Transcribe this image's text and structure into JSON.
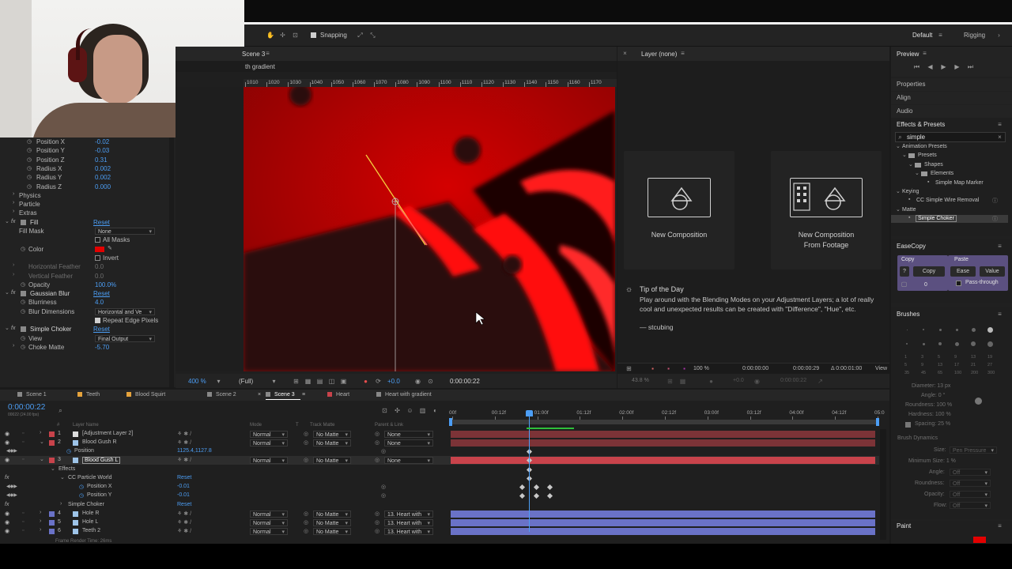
{
  "colors": {
    "accent": "#4c9ef5",
    "red_layer": "#c8434b",
    "blue_layer": "#6a72c7",
    "fill_red": "#e30000",
    "selection": "#5b5080"
  },
  "toolbar": {
    "snapping": "Snapping",
    "workspace_default": "Default",
    "workspace_rigging": "Rigging"
  },
  "composition": {
    "tab": "Scene 3",
    "breadcrumb": "th gradient",
    "ruler": [
      "1010",
      "1020",
      "1030",
      "1040",
      "1050",
      "1060",
      "1070",
      "1080",
      "1090",
      "1100",
      "1110",
      "1120",
      "1130",
      "1140",
      "1150",
      "1160",
      "1170"
    ],
    "zoom": "400 %",
    "resolution": "(Full)",
    "exposure": "+0.0",
    "timecode": "0:00:00:22"
  },
  "layer_panel": {
    "title": "Layer (none)",
    "new_comp": "New Composition",
    "new_comp_footage_1": "New Composition",
    "new_comp_footage_2": "From Footage",
    "tip_title": "Tip of the Day",
    "tip_line1": "Play around with the Blending Modes on your Adjustment Layers; a lot of really",
    "tip_line2": "cool and unexpected results can be created with \"Difference\", \"Hue\", etc.",
    "tip_author": "— stcubing",
    "footer_pct": "100 %",
    "footer_tc1": "0:00:00:00",
    "footer_tc2": "0:00:00:29",
    "footer_tc3": "Δ 0:00:01:00",
    "footer_view": "View",
    "footer2_pct": "43.8 %",
    "footer2_exp": "+0.0",
    "footer2_tc": "0:00:00:22"
  },
  "effects": {
    "rows": [
      {
        "label": "Position X",
        "value": "-0.02"
      },
      {
        "label": "Position Y",
        "value": "-0.03"
      },
      {
        "label": "Position Z",
        "value": "0.31"
      },
      {
        "label": "Radius X",
        "value": "0.002"
      },
      {
        "label": "Radius Y",
        "value": "0.002"
      },
      {
        "label": "Radius Z",
        "value": "0.000"
      }
    ],
    "physics": "Physics",
    "particle": "Particle",
    "extras": "Extras",
    "fill": "Fill",
    "reset": "Reset",
    "fill_mask": "Fill Mask",
    "fill_mask_value": "None",
    "all_masks": "All Masks",
    "color": "Color",
    "invert": "Invert",
    "h_feather": "Horizontal Feather",
    "h_feather_val": "0.0",
    "v_feather": "Vertical Feather",
    "v_feather_val": "0.0",
    "opacity": "Opacity",
    "opacity_val": "100.0%",
    "gaussian": "Gaussian Blur",
    "blurriness": "Blurriness",
    "blurriness_val": "4.0",
    "blur_dim": "Blur Dimensions",
    "blur_dim_val": "Horizontal and Ve",
    "repeat_edge": "Repeat Edge Pixels",
    "simple_choker": "Simple Choker",
    "view": "View",
    "view_val": "Final Output",
    "choke": "Choke Matte",
    "choke_val": "-5.70"
  },
  "right": {
    "preview": "Preview",
    "properties": "Properties",
    "align": "Align",
    "audio": "Audio",
    "effects_presets": "Effects & Presets",
    "search": "simple",
    "tree": [
      "Animation Presets",
      "Presets",
      "Shapes",
      "Elements",
      "Simple Map Marker",
      "Keying",
      "CC Simple Wire Removal",
      "Matte",
      "Simple Choker"
    ],
    "easecopy": "EaseCopy",
    "copy_hdr": "Copy",
    "paste_hdr": "Paste",
    "copy_btn": "Copy",
    "ease_btn": "Ease",
    "value_btn": "Value",
    "q_btn": "?",
    "zero": "0",
    "pass": "Pass-through",
    "brushes": "Brushes",
    "brush_sizes": [
      "1",
      "3",
      "5",
      "9",
      "13",
      "19",
      "5",
      "9",
      "13",
      "17",
      "21",
      "27",
      "35",
      "45",
      "65",
      "100",
      "200",
      "300"
    ],
    "diameter": "Diameter: 13 px",
    "angle": "Angle: 0 °",
    "roundness": "Roundness: 100 %",
    "hardness": "Hardness: 100 %",
    "spacing": "Spacing: 25 %",
    "dynamics": "Brush Dynamics",
    "size": "Size:",
    "size_val": "Pen Pressure",
    "min_size": "Minimum Size: 1 %",
    "angle2": "Angle:",
    "roundness2": "Roundness:",
    "opacity2": "Opacity:",
    "flow": "Flow:",
    "off": "Off",
    "paint": "Paint"
  },
  "timeline": {
    "tabs": [
      "Scene 1",
      "Teeth",
      "Blood Squirt",
      "Scene 2",
      "Scene 3",
      "Heart",
      "Heart with gradient"
    ],
    "tab_colors": [
      "#888888",
      "#e6a33c",
      "#e6a33c",
      "#888888",
      "#888888",
      "#c8434b",
      "#888888"
    ],
    "timecode": "0:00:00:22",
    "fps": "00022 (24.00 fps)",
    "col_hash": "#",
    "col_layer_name": "Layer Name",
    "col_mode": "Mode",
    "col_t": "T",
    "col_track": "Track Matte",
    "col_parent": "Parent & Link",
    "ruler": [
      "00f",
      "00:12f",
      "01:00f",
      "01:12f",
      "02:00f",
      "02:12f",
      "03:00f",
      "03:12f",
      "04:00f",
      "04:12f",
      "05:0"
    ],
    "layers": [
      {
        "num": "1",
        "name": "[Adjustment Layer 2]",
        "mode": "Normal",
        "matte": "No Matte",
        "parent": "None",
        "color": "#c8434b"
      },
      {
        "num": "2",
        "name": "Blood Gush R",
        "mode": "Normal",
        "matte": "No Matte",
        "parent": "None",
        "color": "#c8434b"
      },
      {
        "num": "",
        "name": "Position",
        "value": "1125.4,1127.8"
      },
      {
        "num": "3",
        "name": "Blood Gush L",
        "mode": "Normal",
        "matte": "No Matte",
        "parent": "None",
        "color": "#c8434b"
      },
      {
        "num": "",
        "name": "Effects"
      },
      {
        "num": "",
        "name": "CC Particle World",
        "reset": "Reset"
      },
      {
        "num": "",
        "name": "Position X",
        "value": "-0.01"
      },
      {
        "num": "",
        "name": "Position Y",
        "value": "-0.01"
      },
      {
        "num": "",
        "name": "Simple Choker",
        "reset": "Reset"
      },
      {
        "num": "4",
        "name": "Hole R",
        "mode": "Normal",
        "matte": "No Matte",
        "parent": "13. Heart with",
        "color": "#6a72c7"
      },
      {
        "num": "5",
        "name": "Hole L",
        "mode": "Normal",
        "matte": "No Matte",
        "parent": "13. Heart with",
        "color": "#6a72c7"
      },
      {
        "num": "6",
        "name": "Teeth 2",
        "mode": "Normal",
        "matte": "No Matte",
        "parent": "13. Heart with",
        "color": "#6a72c7"
      }
    ],
    "render_time": "Frame Render Time: 26ms"
  }
}
